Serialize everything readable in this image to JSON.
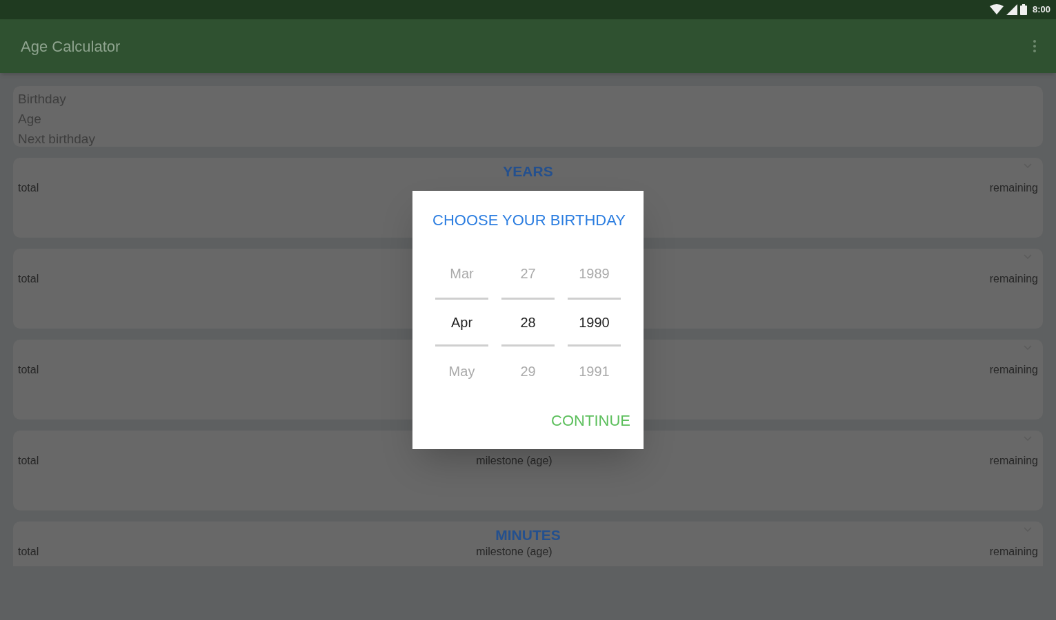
{
  "status_bar": {
    "time": "8:00"
  },
  "app_bar": {
    "title": "Age Calculator"
  },
  "summary": [
    "Birthday",
    "Age",
    "Next birthday"
  ],
  "cards": [
    {
      "title": "YEARS",
      "total": "total",
      "remaining": "remaining"
    },
    {
      "total": "total",
      "remaining": "remaining"
    },
    {
      "total": "total",
      "remaining": "remaining"
    },
    {
      "milestone": "milestone (age)",
      "total": "total",
      "remaining": "remaining"
    },
    {
      "title": "MINUTES",
      "milestone": "milestone (age)",
      "total": "total",
      "remaining": "remaining"
    }
  ],
  "dialog": {
    "title": "CHOOSE YOUR BIRTHDAY",
    "columns": [
      [
        {
          "text": "Mar",
          "selected": false
        },
        {
          "text": "Apr",
          "selected": true
        },
        {
          "text": "May",
          "selected": false
        }
      ],
      [
        {
          "text": "27",
          "selected": false
        },
        {
          "text": "28",
          "selected": true
        },
        {
          "text": "29",
          "selected": false
        }
      ],
      [
        {
          "text": "1989",
          "selected": false
        },
        {
          "text": "1990",
          "selected": true
        },
        {
          "text": "1991",
          "selected": false
        }
      ]
    ],
    "button": "CONTINUE"
  }
}
